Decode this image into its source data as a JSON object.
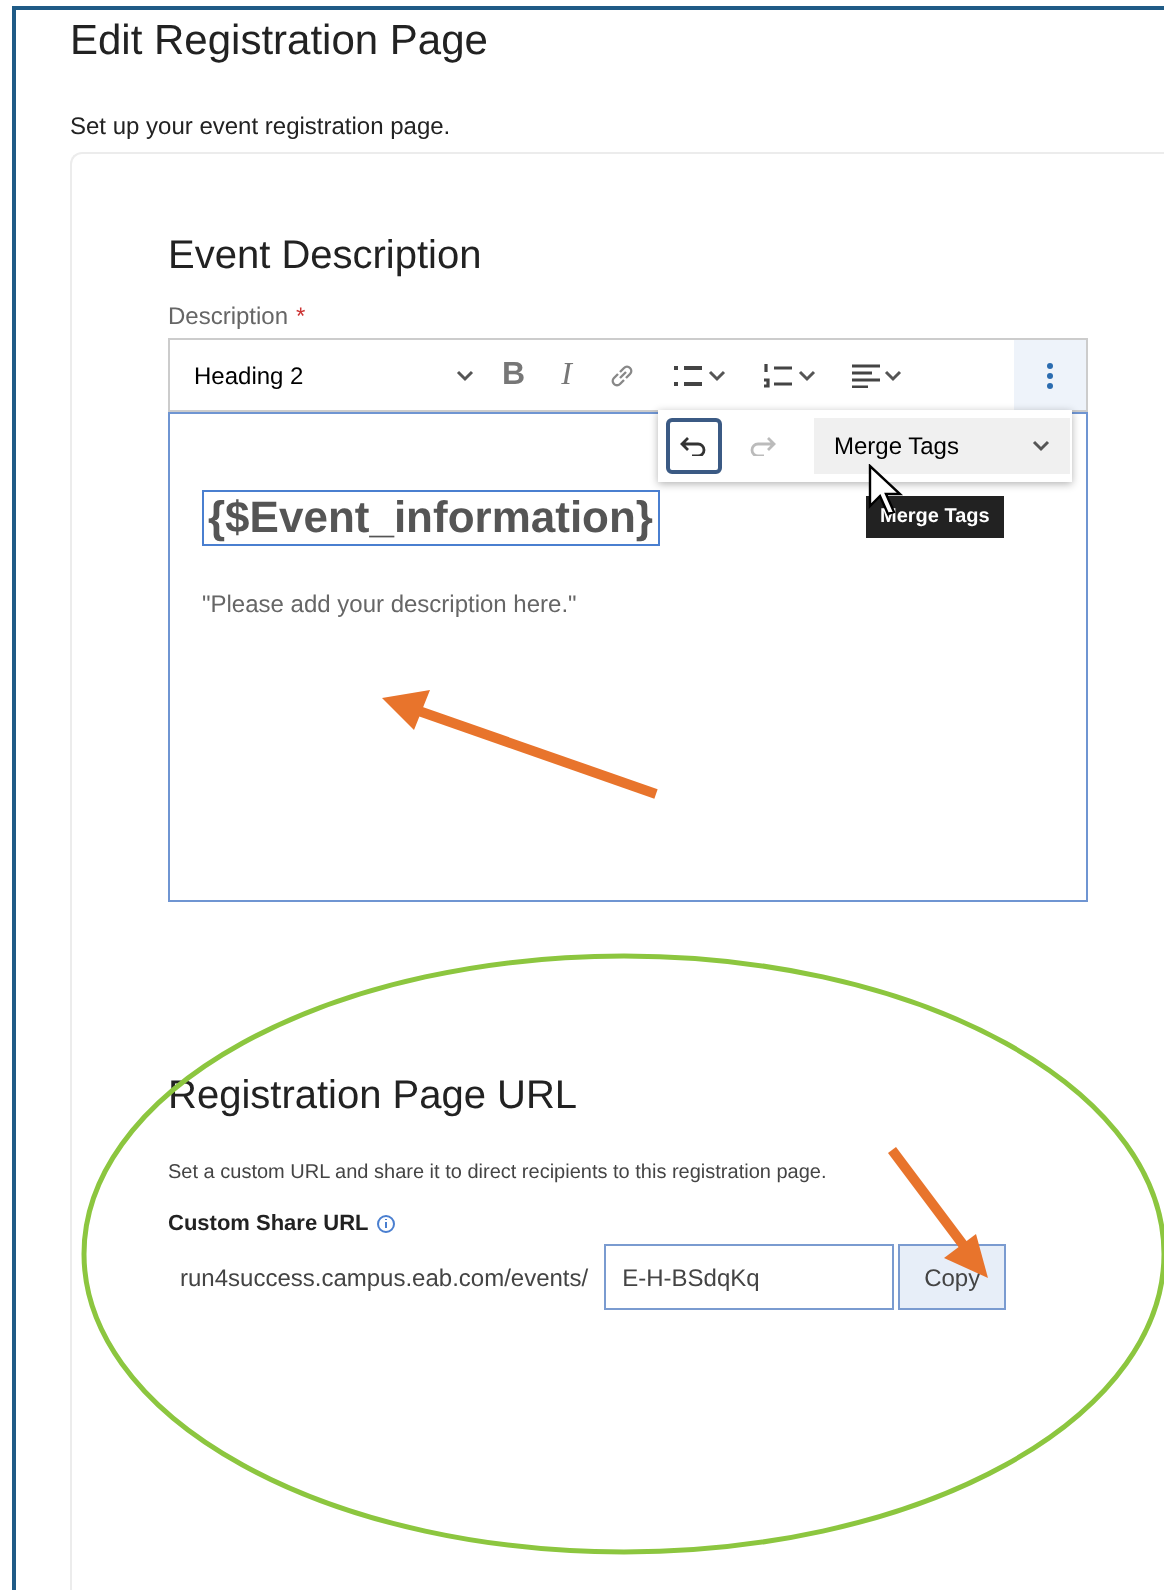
{
  "page": {
    "title": "Edit Registration Page",
    "subtitle": "Set up your event registration page."
  },
  "description_section": {
    "heading": "Event Description",
    "label": "Description",
    "required_mark": "*",
    "toolbar": {
      "style_select": "Heading 2",
      "buttons": [
        {
          "kind": "bold",
          "label": "B"
        },
        {
          "kind": "italic",
          "label": "I"
        },
        {
          "kind": "link"
        },
        {
          "kind": "bullets"
        },
        {
          "kind": "numbers"
        },
        {
          "kind": "align"
        }
      ]
    },
    "overflow_menu": {
      "undo_focused": true,
      "merge_tags": "Merge Tags",
      "tooltip": "Merge Tags"
    },
    "content": {
      "tag": "{$Event_information}",
      "placeholder": "\"Please add your description here.\""
    }
  },
  "url_section": {
    "heading": "Registration Page URL",
    "help": "Set a custom URL and share it to direct recipients to this registration page.",
    "label": "Custom Share URL",
    "prefix": "run4success.campus.eab.com/events/",
    "value": "E-H-BSdqKq",
    "copy": "Copy"
  }
}
